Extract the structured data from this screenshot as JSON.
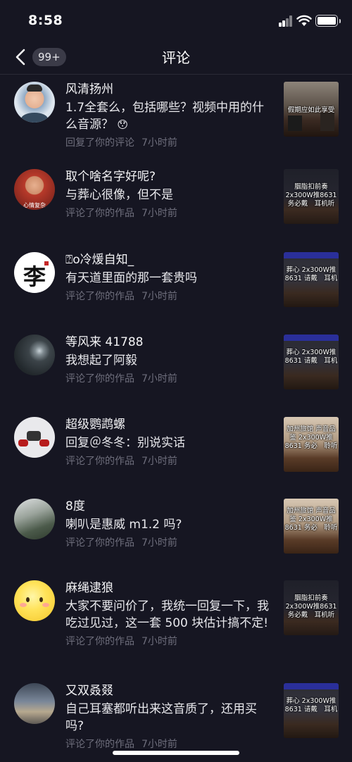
{
  "status_bar": {
    "time": "8:58"
  },
  "nav": {
    "title": "评论",
    "badge": "99+"
  },
  "items": [
    {
      "username": "风清扬州",
      "comment": "1.7全套么，包括哪些？视频中用的什么音源？",
      "emoji": "😯",
      "action": "回复了你的评论",
      "time": "7小时前",
      "thumb_caption": "假期应如此享受"
    },
    {
      "username": "取个啥名字好呢?",
      "comment": "与葬心很像，但不是",
      "action": "评论了你的作品",
      "time": "7小时前",
      "thumb_caption": "胭脂扣前奏 2x300W推8631 务必戴　耳机听"
    },
    {
      "username": "⍰o冷煖自知_",
      "comment": "有天道里面的那一套贵吗",
      "action": "评论了你的作品",
      "time": "7小时前",
      "thumb_caption": "葬心 2x300W推8631 请戴　耳机"
    },
    {
      "username": "等风来 41788",
      "comment": "我想起了阿毅",
      "action": "评论了你的作品",
      "time": "7小时前",
      "thumb_caption": "葬心 2x300W推8631 请戴　耳机"
    },
    {
      "username": "超级鹦鹉螺",
      "comment": "回复＠冬冬：别说实话",
      "action": "评论了你的作品",
      "time": "7小时前",
      "thumb_caption": "加州旅馆 声音品鉴 2x300W推8631 务必　聆听"
    },
    {
      "username": "8度",
      "comment": "喇叭是惠威 m1.2 吗?",
      "action": "评论了你的作品",
      "time": "7小时前",
      "thumb_caption": "加州旅馆 声音品鉴 2x300W推8631 务必　聆听"
    },
    {
      "username": "麻绳逮狼",
      "comment": "大家不要问价了，我统一回复一下，我吃过见过，这一套 500 块估计搞不定!",
      "action": "评论了你的作品",
      "time": "7小时前",
      "thumb_caption": "胭脂扣前奏 2x300W推8631 务必戴　耳机听"
    },
    {
      "username": "又双叒叕",
      "comment": "自己耳塞都听出来这音质了，还用买吗?",
      "action": "评论了你的作品",
      "time": "7小时前",
      "thumb_caption": "葬心 2x300W推8631 请戴　耳机"
    }
  ],
  "colors": {
    "background": "#161622",
    "meta_text": "#6e6e7c",
    "badge_bg": "#3b3b48"
  }
}
